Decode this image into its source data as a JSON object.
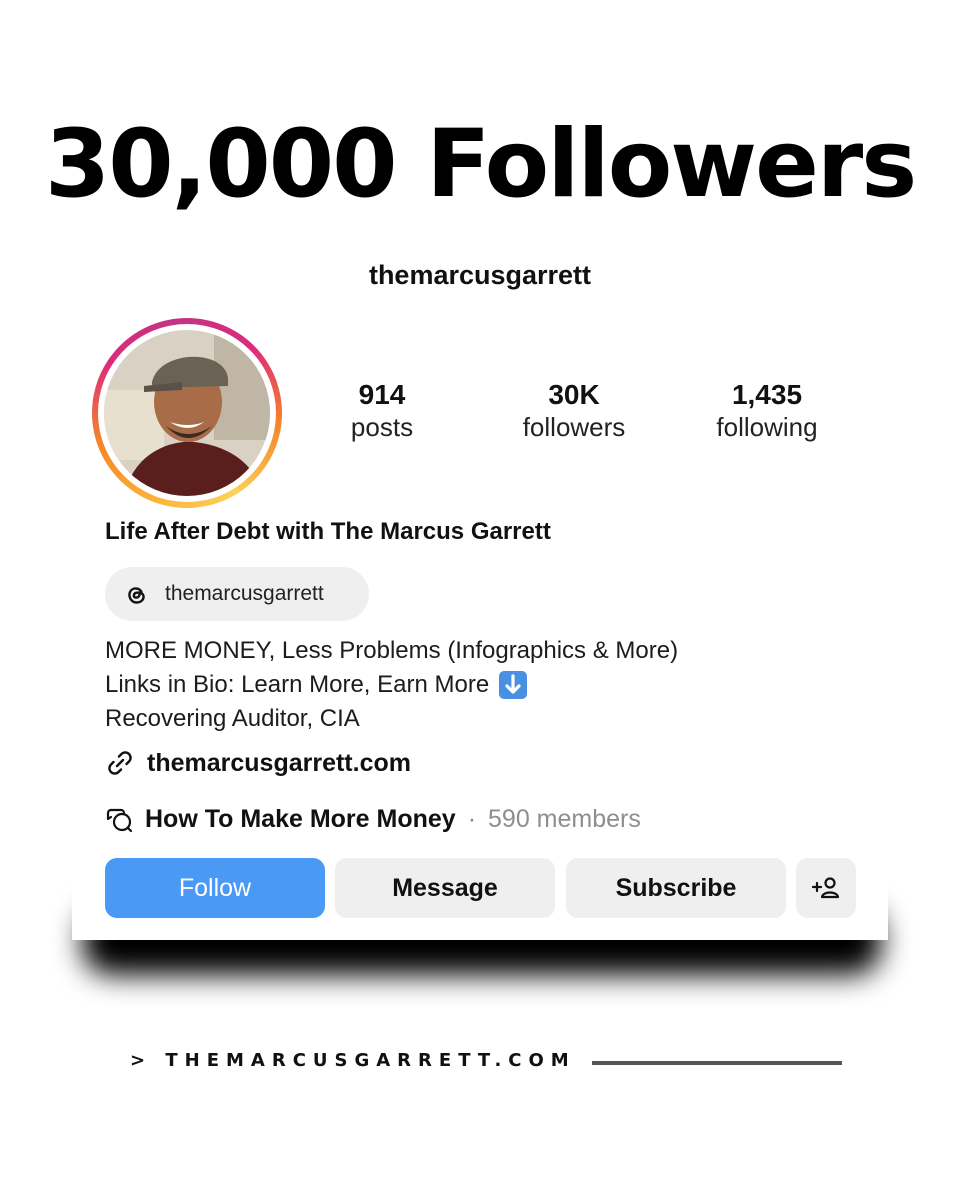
{
  "headline": "30,000 Followers",
  "profile": {
    "username": "themarcusgarrett",
    "stats": [
      {
        "value": "914",
        "label": "posts"
      },
      {
        "value": "30K",
        "label": "followers"
      },
      {
        "value": "1,435",
        "label": "following"
      }
    ],
    "display_name": "Life After Debt with The Marcus Garrett",
    "threads_handle": "themarcusgarrett",
    "bio": {
      "line1": "MORE MONEY, Less Problems (Infographics & More)",
      "line2": "Links in Bio: Learn More, Earn More",
      "line3": "Recovering Auditor, CIA"
    },
    "link": "themarcusgarrett.com",
    "community": {
      "name": "How To Make More Money",
      "separator": "·",
      "members": "590 members"
    },
    "buttons": {
      "follow": "Follow",
      "message": "Message",
      "subscribe": "Subscribe",
      "add_user": "add-user-icon"
    }
  },
  "footer": {
    "text": "> THEMARCUSGARRETT.COM"
  },
  "colors": {
    "follow_button": "#4a99f5",
    "secondary_button": "#efefef",
    "ring_gradient": [
      "#f9b53a",
      "#dd2a7b",
      "#c13584"
    ]
  }
}
